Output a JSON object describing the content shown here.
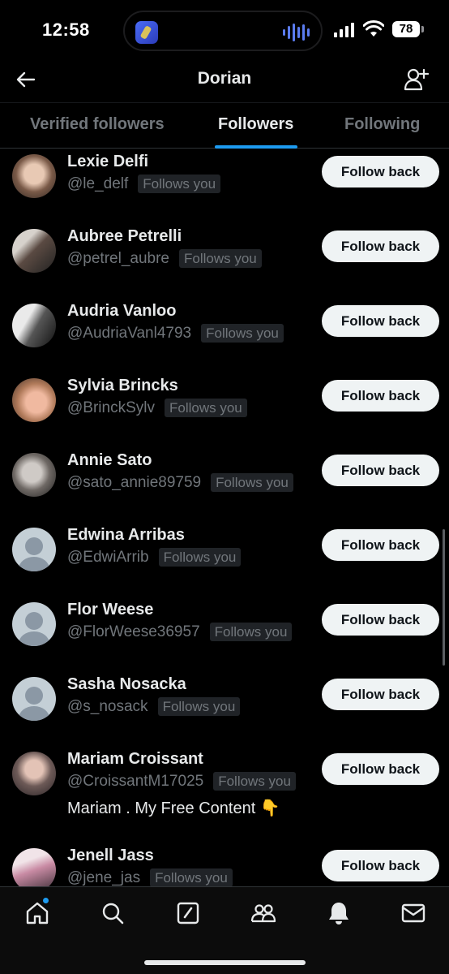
{
  "status": {
    "time": "12:58",
    "battery": "78"
  },
  "header": {
    "title": "Dorian"
  },
  "tabs": [
    {
      "label": "Verified followers"
    },
    {
      "label": "Followers"
    },
    {
      "label": "Following"
    }
  ],
  "users": [
    {
      "name": "Lexie Delfi",
      "handle": "@le_delf",
      "badge": "Follows you",
      "button": "Follow back",
      "avatar": "photo"
    },
    {
      "name": "Aubree Petrelli",
      "handle": "@petrel_aubre",
      "badge": "Follows you",
      "button": "Follow back",
      "avatar": "photo"
    },
    {
      "name": "Audria Vanloo",
      "handle": "@AudriaVanl4793",
      "badge": "Follows you",
      "button": "Follow back",
      "avatar": "photo"
    },
    {
      "name": "Sylvia Brincks",
      "handle": "@BrinckSylv",
      "badge": "Follows you",
      "button": "Follow back",
      "avatar": "photo"
    },
    {
      "name": "Annie Sato",
      "handle": "@sato_annie89759",
      "badge": "Follows you",
      "button": "Follow back",
      "avatar": "photo"
    },
    {
      "name": "Edwina Arribas",
      "handle": "@EdwiArrib",
      "badge": "Follows you",
      "button": "Follow back",
      "avatar": "default"
    },
    {
      "name": "Flor Weese",
      "handle": "@FlorWeese36957",
      "badge": "Follows you",
      "button": "Follow back",
      "avatar": "default"
    },
    {
      "name": "Sasha Nosacka",
      "handle": "@s_nosack",
      "badge": "Follows you",
      "button": "Follow back",
      "avatar": "default"
    },
    {
      "name": "Mariam Croissant",
      "handle": "@CroissantM17025",
      "badge": "Follows you",
      "button": "Follow back",
      "avatar": "photo",
      "bio": "Mariam . My Free Content 👇"
    },
    {
      "name": "Jenell Jass",
      "handle": "@jene_jas",
      "badge": "Follows you",
      "button": "Follow back",
      "avatar": "photo"
    }
  ],
  "nav": {
    "items": [
      "home-icon",
      "search-icon",
      "compose-icon",
      "communities-icon",
      "notifications-icon",
      "messages-icon"
    ]
  },
  "colors": {
    "accent": "#1d9bf0",
    "background": "#000000",
    "button_bg": "#eff3f4"
  }
}
